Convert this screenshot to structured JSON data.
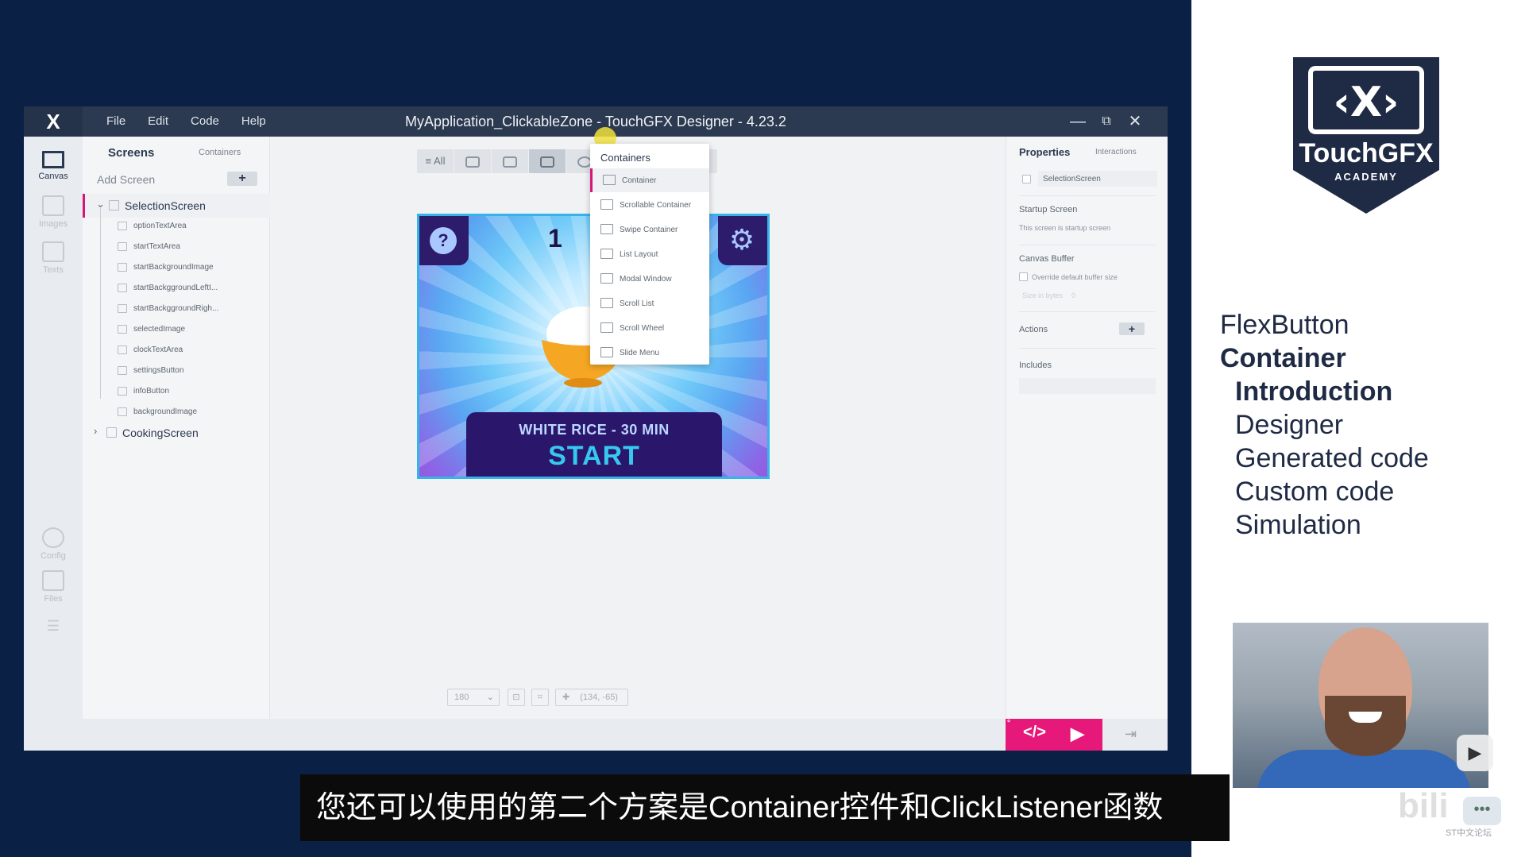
{
  "app": {
    "logo": "X",
    "menu": [
      "File",
      "Edit",
      "Code",
      "Help"
    ],
    "window_title": "MyApplication_ClickableZone - TouchGFX Designer - 4.23.2",
    "window_controls": {
      "minimize": "—",
      "restore": "⧉",
      "close": "✕"
    }
  },
  "nav": [
    {
      "label": "Canvas",
      "icon": "canvas-icon",
      "active": true
    },
    {
      "label": "Images",
      "icon": "images-icon"
    },
    {
      "label": "Texts",
      "icon": "texts-icon"
    },
    {
      "label": "Config",
      "icon": "gear-icon"
    },
    {
      "label": "Files",
      "icon": "folder-icon"
    }
  ],
  "tree": {
    "tab_active": "Screens",
    "tab_other": "Containers",
    "add_screen": "Add Screen",
    "add_plus": "+",
    "screens": [
      {
        "name": "SelectionScreen",
        "expanded": true,
        "chevron": "⌄",
        "children": [
          "optionTextArea",
          "startTextArea",
          "startBackgroundImage",
          "startBackggroundLeftI...",
          "startBackggroundRigh...",
          "selectedImage",
          "clockTextArea",
          "settingsButton",
          "infoButton",
          "backgroundImage"
        ]
      },
      {
        "name": "CookingScreen",
        "expanded": false,
        "chevron": "›"
      }
    ]
  },
  "toolbar": {
    "all_label": "≡ All",
    "buttons": [
      "button-icon",
      "image-icon",
      "container-icon",
      "shapes-icon",
      "progress-icon",
      "3d-icon",
      "layers-icon"
    ]
  },
  "dropdown": {
    "header": "Containers",
    "items": [
      "Container",
      "Scrollable Container",
      "Swipe Container",
      "List Layout",
      "Modal Window",
      "Scroll List",
      "Scroll Wheel",
      "Slide Menu"
    ],
    "active_index": 0
  },
  "device": {
    "clock_partial": "1",
    "info_symbol": "?",
    "settings_symbol": "⚙",
    "option_text": "WHITE RICE - 30 MIN",
    "start_text": "START"
  },
  "zoom": {
    "value": "180",
    "coords": "(134, -65)"
  },
  "properties": {
    "tab_active": "Properties",
    "tab_other": "Interactions",
    "screen_name": "SelectionScreen",
    "startup_title": "Startup Screen",
    "startup_text": "This screen is startup screen",
    "canvas_buffer_title": "Canvas Buffer",
    "override_label": "Override default buffer size",
    "size_label": "Size in bytes",
    "size_value": "0",
    "actions_title": "Actions",
    "actions_plus": "+",
    "includes_title": "Includes"
  },
  "run_bar": {
    "code_symbol": "</>",
    "play_symbol": "▶"
  },
  "academy": {
    "brand": "TouchGFX",
    "academy_word": "ACADEMY",
    "logo_mark": "‹X›"
  },
  "topics": [
    {
      "text": "FlexButton",
      "bold": false,
      "indent": false
    },
    {
      "text": "Container",
      "bold": true,
      "indent": false
    },
    {
      "text": "Introduction",
      "bold": true,
      "indent": true
    },
    {
      "text": "Designer",
      "bold": false,
      "indent": true
    },
    {
      "text": "Generated code",
      "bold": false,
      "indent": true
    },
    {
      "text": "Custom code",
      "bold": false,
      "indent": true
    },
    {
      "text": "Simulation",
      "bold": false,
      "indent": true
    }
  ],
  "subtitle": "您还可以使用的第二个方案是Container控件和ClickListener函数",
  "watermark": "ST中文论坛",
  "colors": {
    "accent": "#e6197a",
    "titlebar": "#2b3a50",
    "device_border": "#36b3e8",
    "navy": "#0b2045"
  }
}
